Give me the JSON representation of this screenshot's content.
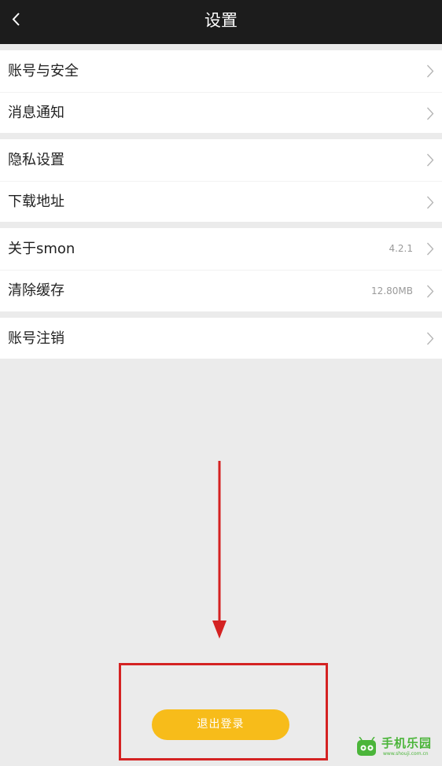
{
  "header": {
    "title": "设置",
    "back_icon": "chevron-left-icon"
  },
  "groups": [
    {
      "items": [
        {
          "label": "账号与安全",
          "value": ""
        },
        {
          "label": "消息通知",
          "value": ""
        }
      ]
    },
    {
      "items": [
        {
          "label": "隐私设置",
          "value": ""
        },
        {
          "label": "下载地址",
          "value": ""
        }
      ]
    },
    {
      "items": [
        {
          "label": "关于smon",
          "value": "4.2.1"
        },
        {
          "label": "清除缓存",
          "value": "12.80MB"
        }
      ]
    },
    {
      "items": [
        {
          "label": "账号注销",
          "value": ""
        }
      ]
    }
  ],
  "footer": {
    "logout_label": "退出登录"
  },
  "annotation": {
    "arrow_color": "#d42222",
    "box_color": "#d42222"
  },
  "watermark": {
    "text": "手机乐园",
    "url": "www.shouji.com.cn"
  },
  "colors": {
    "header_bg": "#1c1c1c",
    "page_bg": "#ebebeb",
    "accent": "#f7bc1a"
  }
}
